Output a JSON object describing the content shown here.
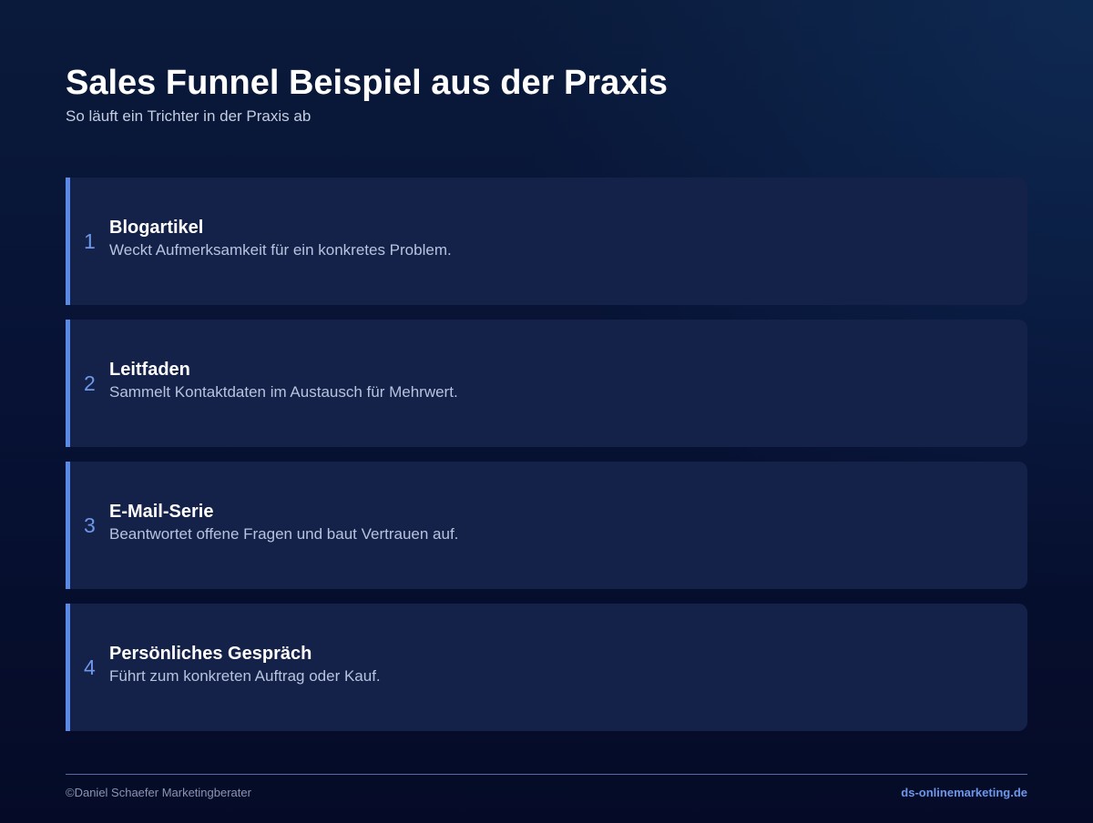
{
  "header": {
    "title": "Sales Funnel Beispiel aus der Praxis",
    "subtitle": "So läuft ein Trichter in der Praxis ab"
  },
  "steps": [
    {
      "number": "1",
      "title": "Blogartikel",
      "description": "Weckt Aufmerksamkeit für ein konkretes Problem."
    },
    {
      "number": "2",
      "title": "Leitfaden",
      "description": "Sammelt Kontaktdaten im Austausch für Mehrwert."
    },
    {
      "number": "3",
      "title": "E-Mail-Serie",
      "description": "Beantwortet offene Fragen und baut Vertrauen auf."
    },
    {
      "number": "4",
      "title": "Persönliches Gespräch",
      "description": "Führt zum konkreten Auftrag oder Kauf."
    }
  ],
  "footer": {
    "copyright": "©Daniel Schaefer Marketingberater",
    "website": "ds-onlinemarketing.de"
  },
  "colors": {
    "accent": "#5b8ae6",
    "card_background": "#142148",
    "page_background": "#081233"
  }
}
